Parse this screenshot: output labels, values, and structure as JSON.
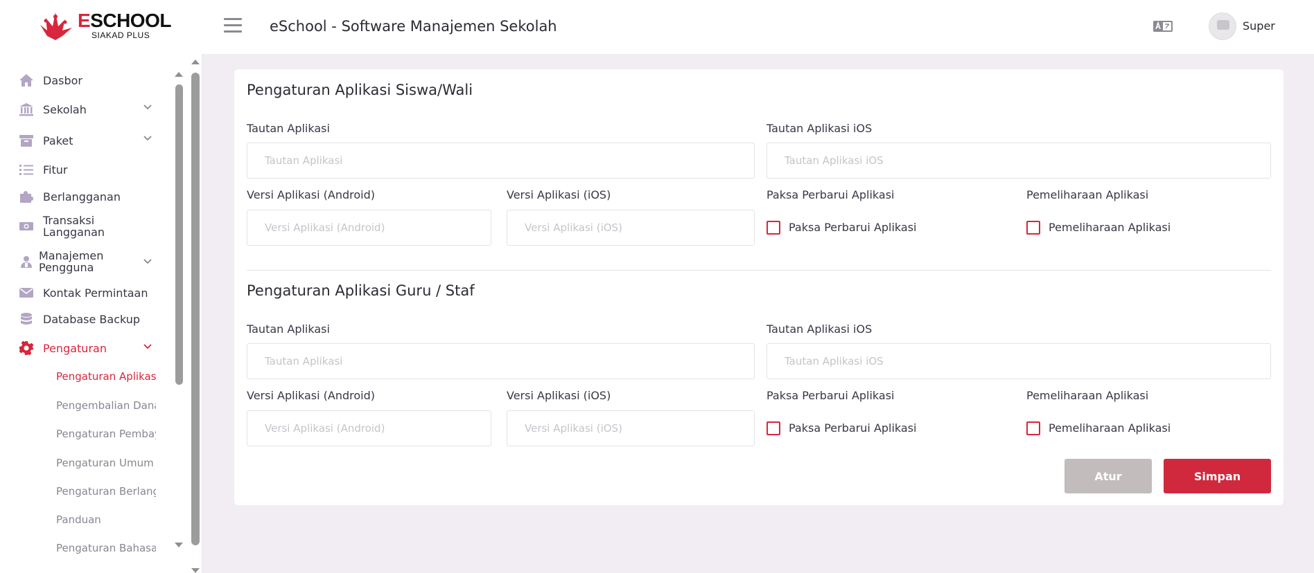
{
  "brand": {
    "name_first": "E",
    "name_rest": "SCHOOL",
    "subtitle": "SIAKAD PLUS",
    "accent_color": "#d7263d"
  },
  "header": {
    "title": "eSchool - Software Manajemen Sekolah",
    "user_name": "Super",
    "menu_icon": "hamburger-icon",
    "language_icon": "translate-icon"
  },
  "sidebar": {
    "items": [
      {
        "label": "Dasbor",
        "icon": "home-icon"
      },
      {
        "label": "Sekolah",
        "icon": "bank-icon",
        "expandable": true
      },
      {
        "label": "Paket",
        "icon": "archive-icon",
        "expandable": true
      },
      {
        "label": "Fitur",
        "icon": "list-icon"
      },
      {
        "label": "Berlangganan",
        "icon": "puzzle-icon"
      },
      {
        "label_line1": "Transaksi",
        "label_line2": "Langganan",
        "icon": "money-icon"
      },
      {
        "label_line1": "Manajemen",
        "label_line2": "Pengguna",
        "icon": "users-icon",
        "expandable": true
      },
      {
        "label": "Kontak Permintaan",
        "icon": "envelope-icon"
      },
      {
        "label": "Database Backup",
        "icon": "database-icon"
      },
      {
        "label": "Pengaturan",
        "icon": "gear-icon",
        "expandable": true,
        "active": true
      }
    ],
    "sub_items": [
      {
        "label": "Pengaturan Aplikasi",
        "active": true
      },
      {
        "label": "Pengembalian Dana"
      },
      {
        "label": "Pengaturan Pembayaran"
      },
      {
        "label": "Pengaturan Umum"
      },
      {
        "label": "Pengaturan Berlangganan"
      },
      {
        "label": "Panduan"
      },
      {
        "label": "Pengaturan Bahasa"
      }
    ]
  },
  "sections": [
    {
      "title": "Pengaturan Aplikasi Siswa/Wali",
      "app_link_label": "Tautan Aplikasi",
      "app_link_placeholder": "Tautan Aplikasi",
      "ios_link_label": "Tautan Aplikasi iOS",
      "ios_link_placeholder": "Tautan Aplikasi iOS",
      "android_version_label": "Versi Aplikasi (Android)",
      "android_version_placeholder": "Versi Aplikasi (Android)",
      "ios_version_label": "Versi Aplikasi (iOS)",
      "ios_version_placeholder": "Versi Aplikasi (iOS)",
      "force_update_label": "Paksa Perbarui Aplikasi",
      "force_update_checkbox": "Paksa Perbarui Aplikasi",
      "maintenance_label": "Pemeliharaan Aplikasi",
      "maintenance_checkbox": "Pemeliharaan Aplikasi"
    },
    {
      "title": "Pengaturan Aplikasi Guru / Staf",
      "app_link_label": "Tautan Aplikasi",
      "app_link_placeholder": "Tautan Aplikasi",
      "ios_link_label": "Tautan Aplikasi iOS",
      "ios_link_placeholder": "Tautan Aplikasi iOS",
      "android_version_label": "Versi Aplikasi (Android)",
      "android_version_placeholder": "Versi Aplikasi (Android)",
      "ios_version_label": "Versi Aplikasi (iOS)",
      "ios_version_placeholder": "Versi Aplikasi (iOS)",
      "force_update_label": "Paksa Perbarui Aplikasi",
      "force_update_checkbox": "Paksa Perbarui Aplikasi",
      "maintenance_label": "Pemeliharaan Aplikasi",
      "maintenance_checkbox": "Pemeliharaan Aplikasi"
    }
  ],
  "actions": {
    "reset_label": "Atur",
    "save_label": "Simpan",
    "reset_color": "#c2bcbc",
    "save_color": "#d0293e"
  }
}
